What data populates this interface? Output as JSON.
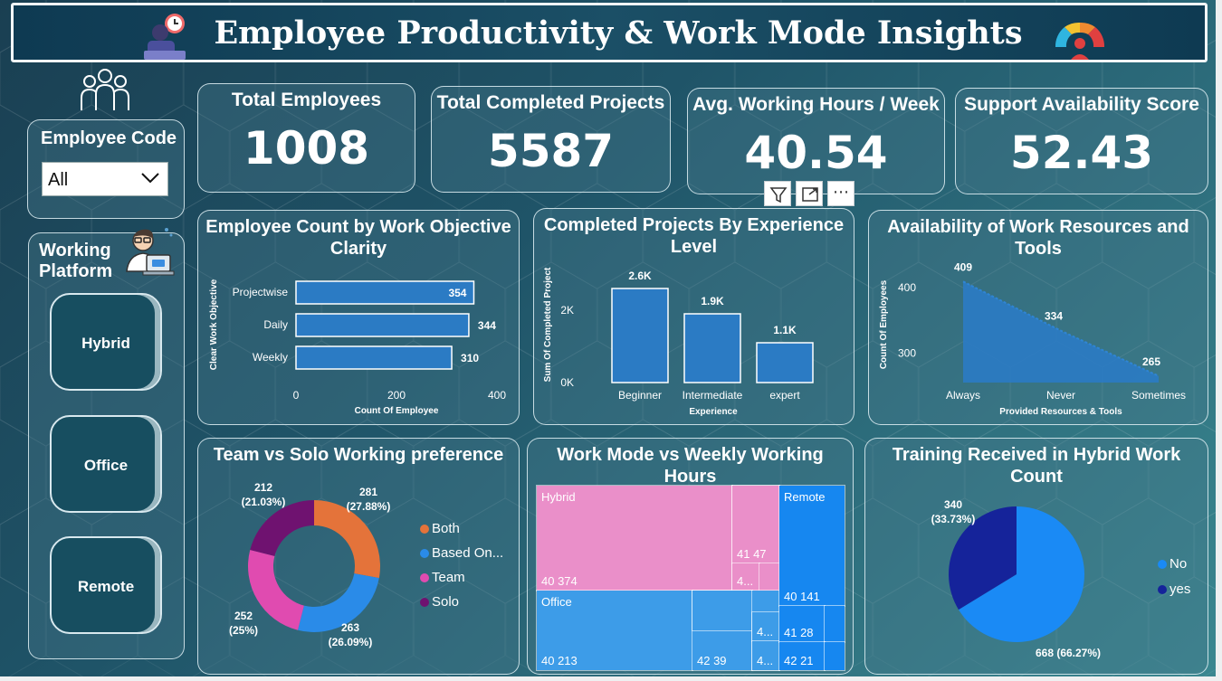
{
  "header": {
    "title": "Employee Productivity & Work Mode Insights"
  },
  "kpis": [
    {
      "title": "Total Employees",
      "value": "1008"
    },
    {
      "title": "Total Completed Projects",
      "value": "5587"
    },
    {
      "title": "Avg. Working Hours / Week",
      "value": "40.54"
    },
    {
      "title": "Support Availability Score",
      "value": "52.43"
    }
  ],
  "filters": {
    "employee_code": {
      "title": "Employee Code",
      "selected": "All"
    },
    "working_platform": {
      "title_line1": "Working",
      "title_line2": "Platform",
      "options": [
        "Hybrid",
        "Office",
        "Remote"
      ]
    }
  },
  "visual_toolbar": {
    "icons": [
      "filter-icon",
      "focus-mode-icon",
      "more-options-icon"
    ],
    "more_label": "⋯"
  },
  "charts": {
    "objective": {
      "title": "Employee Count by Work Objective Clarity",
      "xlabel": "Count Of Employee",
      "ylabel": "Clear Work Objective",
      "categories": [
        "Projectwise",
        "Daily",
        "Weekly"
      ],
      "values": [
        354,
        344,
        310
      ],
      "ticks": [
        "0",
        "200",
        "400"
      ],
      "xlim": [
        0,
        400
      ],
      "color": "#2b7bc4"
    },
    "experience": {
      "title": "Completed Projects By Experience Level",
      "xlabel": "Experience",
      "ylabel": "Sum Of Completed Project",
      "categories": [
        "Beginner",
        "Intermediate",
        "expert"
      ],
      "values": [
        2600,
        1900,
        1100
      ],
      "data_labels": [
        "2.6K",
        "1.9K",
        "1.1K"
      ],
      "ticks": [
        "0K",
        "2K"
      ],
      "ylim": [
        0,
        3000
      ],
      "color": "#2b7bc4"
    },
    "resources": {
      "title": "Availability of Work Resources and Tools",
      "xlabel": "Provided Resources & Tools",
      "ylabel": "Count Of Employees",
      "categories": [
        "Always",
        "Never",
        "Sometimes"
      ],
      "values": [
        409,
        334,
        265
      ],
      "data_labels": [
        "409",
        "334",
        "265"
      ],
      "ticks": [
        "300",
        "400"
      ],
      "ylim": [
        255,
        415
      ],
      "color": "#2b7bc4"
    },
    "team_solo": {
      "title": "Team vs Solo Working preference",
      "slices": [
        {
          "name": "Both",
          "value": 281,
          "label1": "281",
          "label2": "(27.88%)",
          "color": "#e4733a"
        },
        {
          "name": "Based On...",
          "value": 263,
          "label1": "263",
          "label2": "(26.09%)",
          "color": "#2a8be8"
        },
        {
          "name": "Team",
          "value": 252,
          "label1": "252",
          "label2": "(25%)",
          "color": "#e04bb0"
        },
        {
          "name": "Solo",
          "value": 212,
          "label1": "212",
          "label2": "(21.03%)",
          "color": "#6f1270"
        }
      ]
    },
    "work_mode": {
      "title": "Work Mode vs Weekly Working Hours",
      "groups": [
        {
          "name": "Hybrid",
          "color": "#ea8fc9",
          "labels": [
            "40 374",
            "41 47",
            "4..."
          ]
        },
        {
          "name": "Office",
          "color": "#3d9ce8",
          "labels": [
            "40 213",
            "42 39",
            "4...",
            "4..."
          ]
        },
        {
          "name": "Remote",
          "color": "#1687f0",
          "labels": [
            "40 141",
            "41 28",
            "42 21"
          ]
        }
      ]
    },
    "training": {
      "title": "Training Received in Hybrid Work Count",
      "slices": [
        {
          "name": "No",
          "value": 668,
          "label": "668 (66.27%)",
          "color": "#1a8af5"
        },
        {
          "name": "yes",
          "value": 340,
          "label1": "340",
          "label2": "(33.73%)",
          "color": "#15239a"
        }
      ]
    }
  }
}
